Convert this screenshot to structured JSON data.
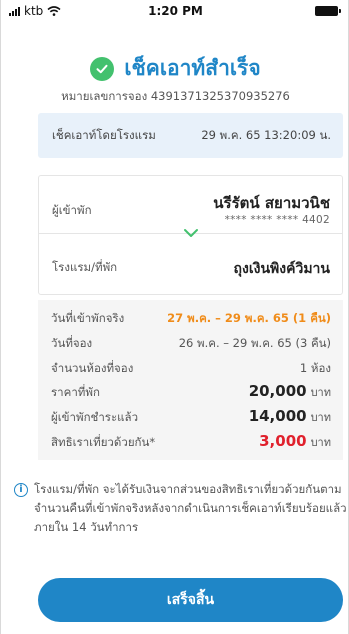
{
  "status_bar": {
    "carrier": "ktb",
    "time": "1:20 PM"
  },
  "header": {
    "title": "เช็คเอาท์สำเร็จ",
    "booking_number": "หมายเลขการจอง 4391371325370935276"
  },
  "checkout_banner": {
    "label": "เช็คเอาท์โดยโรงแรม",
    "datetime": "29 พ.ค. 65 13:20:09 น."
  },
  "guest": {
    "label": "ผู้เข้าพัก",
    "name": "นรีรัตน์ สยามวนิช",
    "card": "**** **** **** 4402"
  },
  "hotel": {
    "label": "โรงแรม/ที่พัก",
    "name": "ถุงเงินพิงค์วิมาน"
  },
  "details": [
    {
      "label": "วันที่เข้าพักจริง",
      "value": "27 พ.ค. – 29 พ.ค. 65 (1 คืน)",
      "style": "orange"
    },
    {
      "label": "วันที่จอง",
      "value": "26 พ.ค. – 29 พ.ค. 65 (3 คืน)",
      "style": "plain"
    },
    {
      "label": "จำนวนห้องที่จอง",
      "value": "1 ห้อง",
      "style": "plain"
    },
    {
      "label": "ราคาที่พัก",
      "amount": "20,000",
      "unit": "บาท",
      "style": "amount"
    },
    {
      "label": "ผู้เข้าพักชำระแล้ว",
      "amount": "14,000",
      "unit": "บาท",
      "style": "amount"
    },
    {
      "label": "สิทธิเราเที่ยวด้วยกัน*",
      "amount": "3,000",
      "unit": "บาท",
      "style": "amount-red"
    }
  ],
  "info": {
    "icon": "info-icon",
    "text": "โรงแรม/ที่พัก จะได้รับเงินจากส่วนของสิทธิเราเที่ยวด้วยกันตามจำนวนคืนที่เข้าพักจริงหลังจากดำเนินการเช็คเอาท์เรียบร้อยแล้ว ภายใน 14 วันทำการ"
  },
  "finish_button": {
    "label": "เสร็จสิ้น"
  },
  "colors": {
    "primary": "#1f86c7",
    "success": "#43c16e",
    "orange": "#f08c1a",
    "red": "#e0202c",
    "banner_bg": "#e8f1fa"
  }
}
